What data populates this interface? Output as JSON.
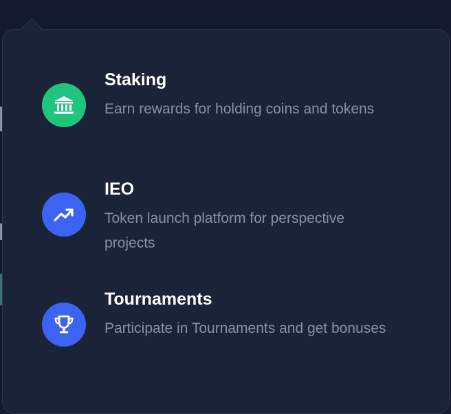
{
  "colors": {
    "panel_bg": "#1b2339",
    "page_bg": "#131a2b",
    "title": "#ffffff",
    "description": "#8690a7",
    "staking_accent": "#21c47d",
    "ieo_accent": "#3d63f2",
    "tournaments_accent": "#3d63f2"
  },
  "menu": {
    "items": [
      {
        "id": "staking",
        "title": "Staking",
        "description": "Earn rewards for holding coins and tokens",
        "icon": "bank-icon",
        "color": "#21c47d"
      },
      {
        "id": "ieo",
        "title": "IEO",
        "description": "Token launch platform for perspective projects",
        "icon": "trending-up-icon",
        "color": "#3d63f2"
      },
      {
        "id": "tournaments",
        "title": "Tournaments",
        "description": "Participate in Tournaments and get bonuses",
        "icon": "trophy-icon",
        "color": "#3d63f2"
      }
    ]
  }
}
